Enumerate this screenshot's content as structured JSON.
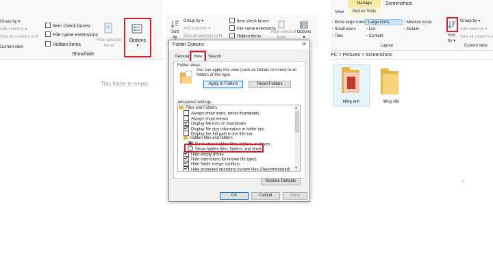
{
  "left_window": {
    "group_by": "Group by",
    "add_columns": "Add columns",
    "size_all": "Size all columns to fit",
    "item_check_boxes": "Item check boxes",
    "file_name_extensions": "File name extensions",
    "hidden_items": "Hidden items",
    "hide_selected_line1": "Hide selected",
    "hide_selected_line2": "items",
    "options": "Options",
    "group_current_view": "Current view",
    "group_show_hide": "Show/hide",
    "empty_message": "This folder is empty."
  },
  "middle_window": {
    "sort_line1": "Sort",
    "sort_line2": "by",
    "group_by": "Group by",
    "add_columns": "Add columns",
    "size_all": "Size all columns to fit",
    "item_check_boxes": "Item check boxes",
    "file_name_extensions": "File name extensions",
    "hidden_items": "Hidden items",
    "hide_selected_line1": "Hide selected",
    "hide_selected_line2": "items",
    "options": "Options"
  },
  "right_window": {
    "manage_tab": "Manage",
    "title": "Screenshots",
    "view_tab": "View",
    "picture_tools": "Picture Tools",
    "extra_large_icons": "Extra large icons",
    "large_icons": "Large icons",
    "medium_icons": "Medium icons",
    "small_icons": "Small icons",
    "list": "List",
    "details": "Details",
    "tiles": "Tiles",
    "content": "Content",
    "layout_label": "Layout",
    "sort_line1": "Sort",
    "sort_line2": "by",
    "group_by": "Group by",
    "add_columns": "Add columns",
    "size_all": "Size all columns to fit",
    "current_view": "Current view",
    "breadcrumb": "PC  >  Pictures  >  Screenshots",
    "folder1": "tiếng anh",
    "folder2": "tiếng việt"
  },
  "dialog": {
    "title": "Folder Options",
    "tabs": [
      "General",
      "View",
      "Search"
    ],
    "folder_views_label": "Folder views",
    "folder_views_text_line1": "You can apply this view (such as Details or Icons) to all",
    "folder_views_text_line2": "folders of this type.",
    "apply_to_folders": "Apply to Folders",
    "reset_folders": "Reset Folders",
    "advanced_label": "Advanced settings:",
    "tree": [
      {
        "label": "Files and Folders",
        "kind": "folder",
        "checked": false,
        "indent": 0
      },
      {
        "label": "Always show icons, never thumbnails",
        "kind": "check",
        "checked": false,
        "indent": 1
      },
      {
        "label": "Always show menus",
        "kind": "check",
        "checked": false,
        "indent": 1
      },
      {
        "label": "Display file icon on thumbnails",
        "kind": "check",
        "checked": true,
        "indent": 1
      },
      {
        "label": "Display file size information in folder tips",
        "kind": "check",
        "checked": true,
        "indent": 1
      },
      {
        "label": "Display the full path in the title bar",
        "kind": "check",
        "checked": false,
        "indent": 1
      },
      {
        "label": "Hidden files and folders",
        "kind": "folder",
        "checked": false,
        "indent": 1
      },
      {
        "label": "Don't show hidden files, folders, or drives",
        "kind": "radio",
        "checked": true,
        "indent": 2
      },
      {
        "label": "Show hidden files, folders, and drives",
        "kind": "radio",
        "checked": false,
        "indent": 2
      },
      {
        "label": "Hide empty drives",
        "kind": "check",
        "checked": true,
        "indent": 1
      },
      {
        "label": "Hide extensions for known file types",
        "kind": "check",
        "checked": true,
        "indent": 1
      },
      {
        "label": "Hide folder merge conflicts",
        "kind": "check",
        "checked": true,
        "indent": 1
      },
      {
        "label": "Hide protected operating system files (Recommended)",
        "kind": "check",
        "checked": true,
        "indent": 1
      }
    ],
    "restore_defaults": "Restore Defaults",
    "ok": "OK",
    "cancel": "Cancel",
    "apply": "Apply"
  },
  "colors": {
    "highlight_red": "#d21f2a",
    "manage_tab_bg": "#f7e9a0",
    "selection_blue": "#cce4f7"
  }
}
